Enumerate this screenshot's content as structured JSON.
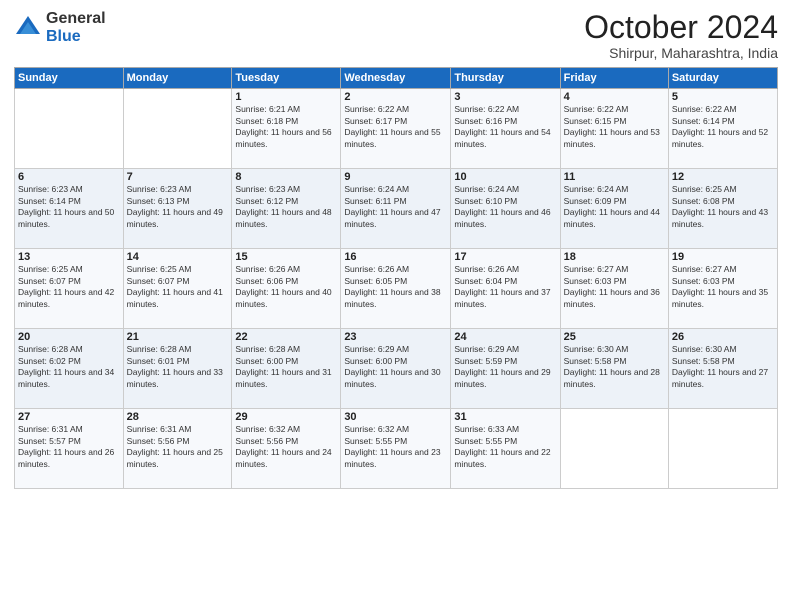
{
  "logo": {
    "general": "General",
    "blue": "Blue"
  },
  "header": {
    "month": "October 2024",
    "location": "Shirpur, Maharashtra, India"
  },
  "weekdays": [
    "Sunday",
    "Monday",
    "Tuesday",
    "Wednesday",
    "Thursday",
    "Friday",
    "Saturday"
  ],
  "weeks": [
    [
      {
        "day": "",
        "info": ""
      },
      {
        "day": "",
        "info": ""
      },
      {
        "day": "1",
        "info": "Sunrise: 6:21 AM\nSunset: 6:18 PM\nDaylight: 11 hours and 56 minutes."
      },
      {
        "day": "2",
        "info": "Sunrise: 6:22 AM\nSunset: 6:17 PM\nDaylight: 11 hours and 55 minutes."
      },
      {
        "day": "3",
        "info": "Sunrise: 6:22 AM\nSunset: 6:16 PM\nDaylight: 11 hours and 54 minutes."
      },
      {
        "day": "4",
        "info": "Sunrise: 6:22 AM\nSunset: 6:15 PM\nDaylight: 11 hours and 53 minutes."
      },
      {
        "day": "5",
        "info": "Sunrise: 6:22 AM\nSunset: 6:14 PM\nDaylight: 11 hours and 52 minutes."
      }
    ],
    [
      {
        "day": "6",
        "info": "Sunrise: 6:23 AM\nSunset: 6:14 PM\nDaylight: 11 hours and 50 minutes."
      },
      {
        "day": "7",
        "info": "Sunrise: 6:23 AM\nSunset: 6:13 PM\nDaylight: 11 hours and 49 minutes."
      },
      {
        "day": "8",
        "info": "Sunrise: 6:23 AM\nSunset: 6:12 PM\nDaylight: 11 hours and 48 minutes."
      },
      {
        "day": "9",
        "info": "Sunrise: 6:24 AM\nSunset: 6:11 PM\nDaylight: 11 hours and 47 minutes."
      },
      {
        "day": "10",
        "info": "Sunrise: 6:24 AM\nSunset: 6:10 PM\nDaylight: 11 hours and 46 minutes."
      },
      {
        "day": "11",
        "info": "Sunrise: 6:24 AM\nSunset: 6:09 PM\nDaylight: 11 hours and 44 minutes."
      },
      {
        "day": "12",
        "info": "Sunrise: 6:25 AM\nSunset: 6:08 PM\nDaylight: 11 hours and 43 minutes."
      }
    ],
    [
      {
        "day": "13",
        "info": "Sunrise: 6:25 AM\nSunset: 6:07 PM\nDaylight: 11 hours and 42 minutes."
      },
      {
        "day": "14",
        "info": "Sunrise: 6:25 AM\nSunset: 6:07 PM\nDaylight: 11 hours and 41 minutes."
      },
      {
        "day": "15",
        "info": "Sunrise: 6:26 AM\nSunset: 6:06 PM\nDaylight: 11 hours and 40 minutes."
      },
      {
        "day": "16",
        "info": "Sunrise: 6:26 AM\nSunset: 6:05 PM\nDaylight: 11 hours and 38 minutes."
      },
      {
        "day": "17",
        "info": "Sunrise: 6:26 AM\nSunset: 6:04 PM\nDaylight: 11 hours and 37 minutes."
      },
      {
        "day": "18",
        "info": "Sunrise: 6:27 AM\nSunset: 6:03 PM\nDaylight: 11 hours and 36 minutes."
      },
      {
        "day": "19",
        "info": "Sunrise: 6:27 AM\nSunset: 6:03 PM\nDaylight: 11 hours and 35 minutes."
      }
    ],
    [
      {
        "day": "20",
        "info": "Sunrise: 6:28 AM\nSunset: 6:02 PM\nDaylight: 11 hours and 34 minutes."
      },
      {
        "day": "21",
        "info": "Sunrise: 6:28 AM\nSunset: 6:01 PM\nDaylight: 11 hours and 33 minutes."
      },
      {
        "day": "22",
        "info": "Sunrise: 6:28 AM\nSunset: 6:00 PM\nDaylight: 11 hours and 31 minutes."
      },
      {
        "day": "23",
        "info": "Sunrise: 6:29 AM\nSunset: 6:00 PM\nDaylight: 11 hours and 30 minutes."
      },
      {
        "day": "24",
        "info": "Sunrise: 6:29 AM\nSunset: 5:59 PM\nDaylight: 11 hours and 29 minutes."
      },
      {
        "day": "25",
        "info": "Sunrise: 6:30 AM\nSunset: 5:58 PM\nDaylight: 11 hours and 28 minutes."
      },
      {
        "day": "26",
        "info": "Sunrise: 6:30 AM\nSunset: 5:58 PM\nDaylight: 11 hours and 27 minutes."
      }
    ],
    [
      {
        "day": "27",
        "info": "Sunrise: 6:31 AM\nSunset: 5:57 PM\nDaylight: 11 hours and 26 minutes."
      },
      {
        "day": "28",
        "info": "Sunrise: 6:31 AM\nSunset: 5:56 PM\nDaylight: 11 hours and 25 minutes."
      },
      {
        "day": "29",
        "info": "Sunrise: 6:32 AM\nSunset: 5:56 PM\nDaylight: 11 hours and 24 minutes."
      },
      {
        "day": "30",
        "info": "Sunrise: 6:32 AM\nSunset: 5:55 PM\nDaylight: 11 hours and 23 minutes."
      },
      {
        "day": "31",
        "info": "Sunrise: 6:33 AM\nSunset: 5:55 PM\nDaylight: 11 hours and 22 minutes."
      },
      {
        "day": "",
        "info": ""
      },
      {
        "day": "",
        "info": ""
      }
    ]
  ]
}
